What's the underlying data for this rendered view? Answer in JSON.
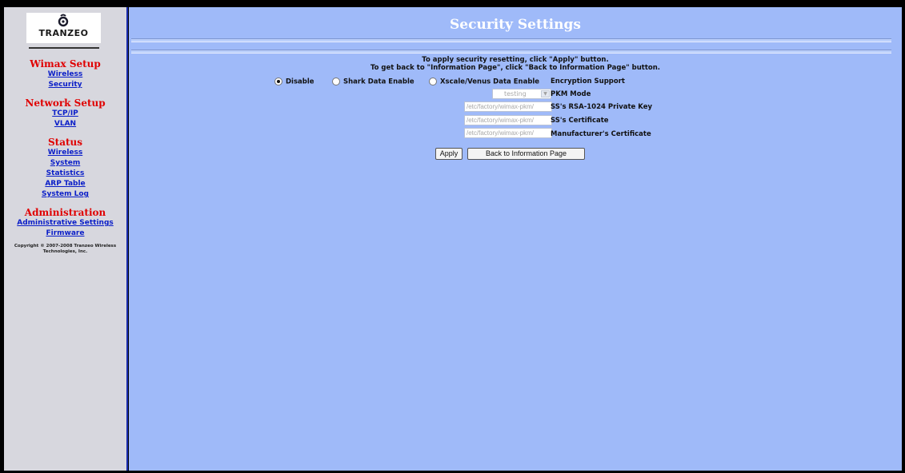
{
  "brand": {
    "logo_text": "TRANZEO"
  },
  "sidebar": {
    "sections": [
      {
        "title": "Wimax Setup",
        "links": [
          "Wireless",
          "Security"
        ]
      },
      {
        "title": "Network Setup",
        "links": [
          "TCP/IP",
          "VLAN"
        ]
      },
      {
        "title": "Status",
        "links": [
          "Wireless",
          "System",
          "Statistics",
          "ARP Table",
          "System Log"
        ]
      },
      {
        "title": "Administration",
        "links": [
          "Administrative Settings",
          "Firmware"
        ]
      }
    ],
    "copyright": "Copyright © 2007-2008 Tranzeo Wireless Technologies, Inc."
  },
  "page": {
    "title": "Security Settings",
    "instructions": [
      "To apply security resetting, click \"Apply\" button.",
      "To get back to \"Information Page\", click \"Back to Information Page\" button."
    ]
  },
  "encryption": {
    "options": [
      "Disable",
      "Shark Data Enable",
      "Xscale/Venus Data Enable"
    ],
    "selected": "Disable",
    "label": "Encryption Support"
  },
  "pkm": {
    "value": "testing",
    "label": "PKM Mode"
  },
  "fields": [
    {
      "value": "/etc/factory/wimax-pkm/",
      "label": "SS's RSA-1024 Private Key"
    },
    {
      "value": "/etc/factory/wimax-pkm/",
      "label": "SS's Certificate"
    },
    {
      "value": "/etc/factory/wimax-pkm/",
      "label": "Manufacturer's Certificate"
    }
  ],
  "buttons": {
    "apply": "Apply",
    "back": "Back to Information Page"
  }
}
